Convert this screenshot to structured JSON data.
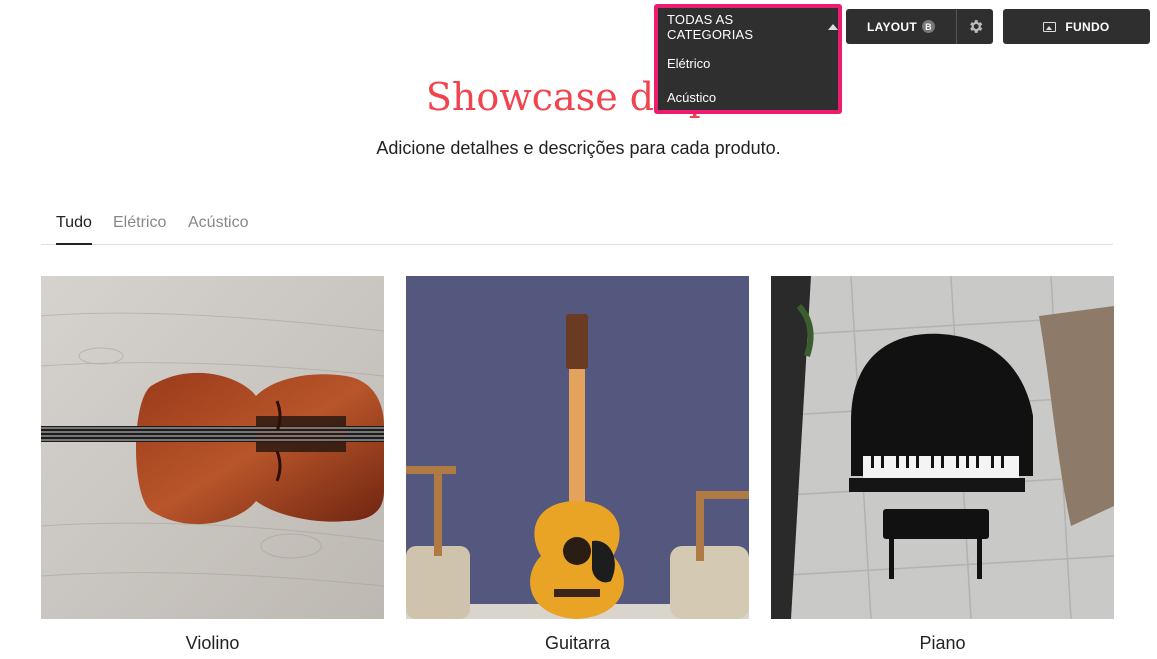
{
  "toolbar": {
    "category_dropdown": {
      "label": "TODAS AS CATEGORIAS",
      "options": [
        "Elétrico",
        "Acústico"
      ]
    },
    "layout_label": "LAYOUT",
    "layout_badge": "B",
    "background_label": "FUNDO",
    "highlight_color": "#ec1c6e"
  },
  "header": {
    "title": "Showcase de pr",
    "subtitle": "Adicione detalhes e descrições para cada produto."
  },
  "tabs": [
    {
      "label": "Tudo",
      "active": true
    },
    {
      "label": "Elétrico",
      "active": false
    },
    {
      "label": "Acústico",
      "active": false
    }
  ],
  "products": [
    {
      "name": "Violino",
      "image": "violin-photo"
    },
    {
      "name": "Guitarra",
      "image": "guitar-photo"
    },
    {
      "name": "Piano",
      "image": "piano-photo"
    }
  ],
  "colors": {
    "title": "#f0454f",
    "toolbar_bg": "#2f2f2f"
  }
}
